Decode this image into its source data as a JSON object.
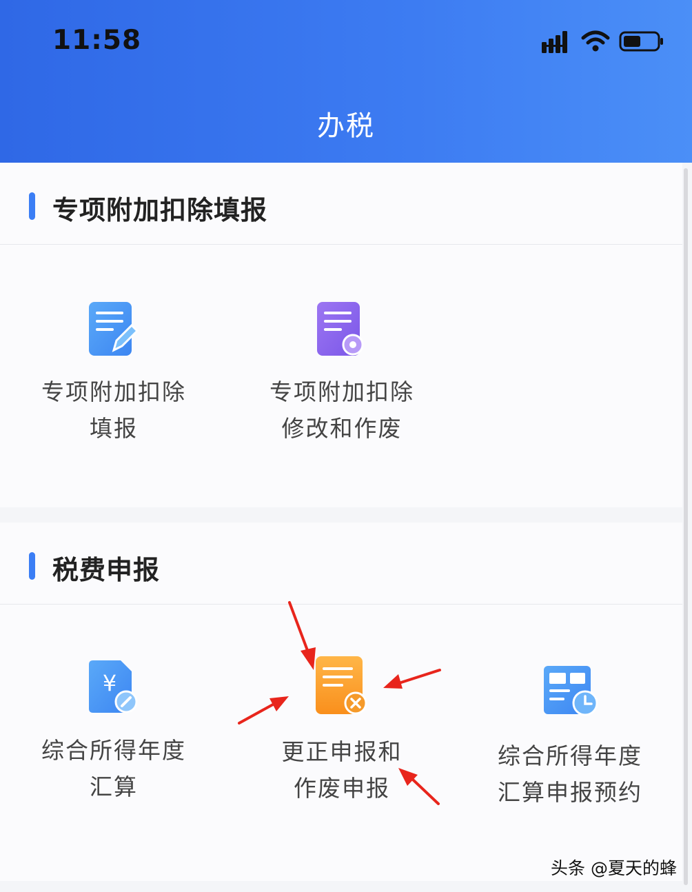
{
  "status_bar": {
    "time": "11:58"
  },
  "header": {
    "title": "办税"
  },
  "sections": [
    {
      "title": "专项附加扣除填报",
      "tiles": [
        {
          "line1": "专项附加扣除",
          "line2": "填报",
          "icon": "document-edit-icon"
        },
        {
          "line1": "专项附加扣除",
          "line2": "修改和作废",
          "icon": "document-settings-icon"
        }
      ]
    },
    {
      "title": "税费申报",
      "tiles": [
        {
          "line1": "综合所得年度",
          "line2": "汇算",
          "icon": "yuan-document-icon"
        },
        {
          "line1": "更正申报和",
          "line2": "作废申报",
          "icon": "document-cancel-icon"
        },
        {
          "line1": "综合所得年度",
          "line2": "汇算申报预约",
          "icon": "calendar-clock-icon"
        }
      ]
    }
  ],
  "watermark": "头条 @夏天的蜂",
  "colors": {
    "header_start": "#2f68e6",
    "header_end": "#4b8ff7",
    "accent": "#3b7ef5",
    "annotation_arrow": "#e8251c"
  }
}
